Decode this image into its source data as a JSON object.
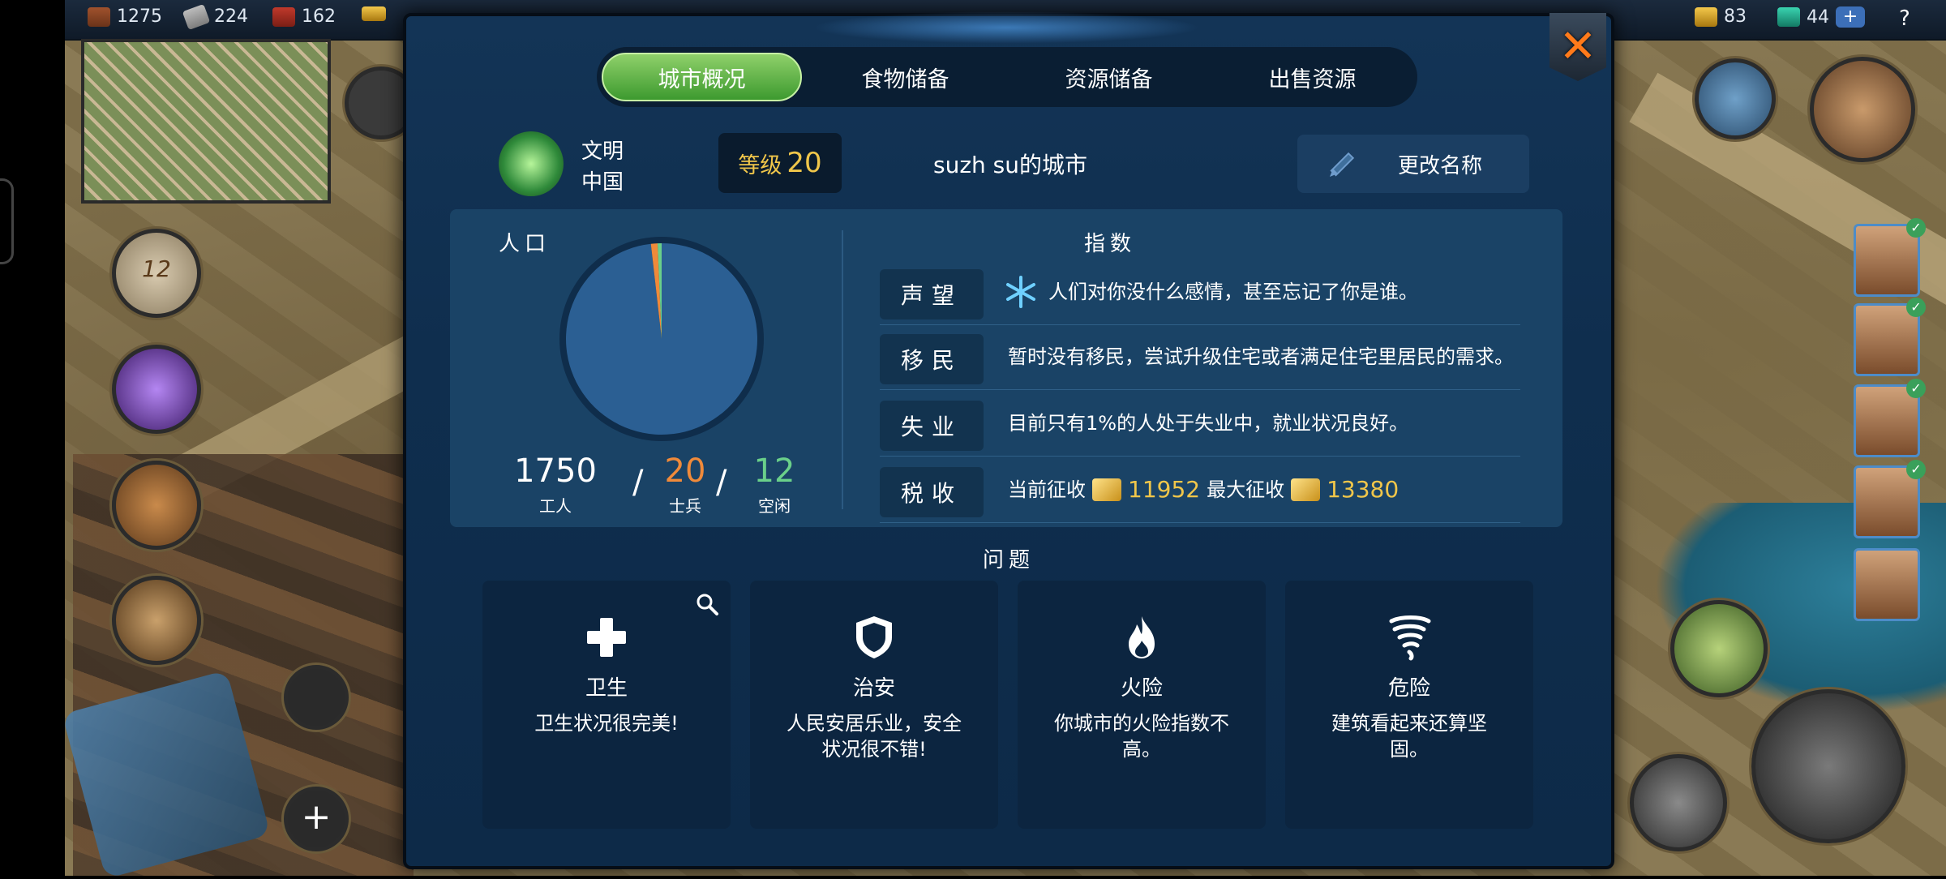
{
  "topbar": {
    "wood": "1275",
    "tools": "224",
    "bricks": "162",
    "gold": "83",
    "gems": "44",
    "plus": "+",
    "help": "?"
  },
  "widgets": {
    "calendar_day": "12",
    "add": "+"
  },
  "tabs": [
    {
      "label": "城市概况",
      "active": true
    },
    {
      "label": "食物储备",
      "active": false
    },
    {
      "label": "资源储备",
      "active": false
    },
    {
      "label": "出售资源",
      "active": false
    }
  ],
  "close_icon": "✕",
  "civ": {
    "label": "文明",
    "name": "中国"
  },
  "level": {
    "label": "等级",
    "value": "20"
  },
  "city_name": "suzh su的城市",
  "rename_label": "更改名称",
  "population": {
    "title": "人口",
    "workers": {
      "value": "1750",
      "label": "工人",
      "color": "#ffffff"
    },
    "soldiers": {
      "value": "20",
      "label": "士兵",
      "color": "#f08a3a"
    },
    "idle": {
      "value": "12",
      "label": "空闲",
      "color": "#6ad08a"
    },
    "separator": "/"
  },
  "indices": {
    "title": "指数",
    "rows": [
      {
        "label": "声望",
        "text": "人们对你没什么感情，甚至忘记了你是谁。"
      },
      {
        "label": "移民",
        "text": "暂时没有移民，尝试升级住宅或者满足住宅里居民的需求。"
      },
      {
        "label": "失业",
        "text": "目前只有1%的人处于失业中，就业状况良好。"
      },
      {
        "label": "税收",
        "current_label": "当前征收",
        "current": "11952",
        "max_label": "最大征收",
        "max": "13380"
      }
    ]
  },
  "issues": {
    "title": "问题",
    "items": [
      {
        "title": "卫生",
        "desc": "卫生状况很完美!",
        "icon": "plus-icon"
      },
      {
        "title": "治安",
        "desc": "人民安居乐业，安全状况很不错!",
        "icon": "shield-icon"
      },
      {
        "title": "火险",
        "desc": "你城市的火险指数不高。",
        "icon": "flame-icon"
      },
      {
        "title": "危险",
        "desc": "建筑看起来还算坚固。",
        "icon": "tornado-icon"
      }
    ]
  }
}
